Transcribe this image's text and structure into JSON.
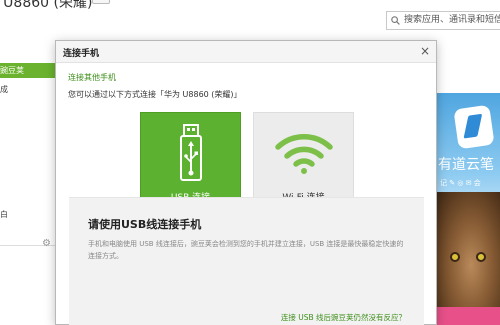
{
  "app": {
    "title": "/ U8860 (荣耀)",
    "title_badge": "",
    "search_placeholder": "搜索应用、通讯录和短信",
    "search_icon": "search-icon"
  },
  "sidebar": {
    "items": [
      {
        "label": "豌豆荚",
        "active": true
      },
      {
        "label": "成",
        "active": false
      },
      {
        "label": "白",
        "active": false
      }
    ],
    "gear_icon": "gear-icon"
  },
  "right_panel": {
    "banner_text": "有道云笔",
    "banner_sub": "记 ✎ ◎ ✉ 会"
  },
  "dialog": {
    "title": "连接手机",
    "close_icon": "close-icon",
    "other_link": "连接其他手机",
    "instruction": "您可以通过以下方式连接「华为 U8860 (荣耀)」",
    "options": [
      {
        "id": "usb",
        "label": "USB 连接",
        "icon": "usb-icon",
        "selected": true
      },
      {
        "id": "wifi",
        "label": "Wi-Fi 连接",
        "icon": "wifi-icon",
        "selected": false
      }
    ],
    "info": {
      "title": "请使用USB线连接手机",
      "body": "手机和电脑使用 USB 线连接后，豌豆荚会检测到您的手机并建立连接，USB 连接是最快最稳定快速的连接方式。",
      "link": "连接 USB 线后豌豆荚仍然没有反应？"
    }
  },
  "colors": {
    "accent_green": "#5cb130",
    "link_green": "#3d8f1a",
    "wifi_icon_green": "#7cc04a"
  }
}
